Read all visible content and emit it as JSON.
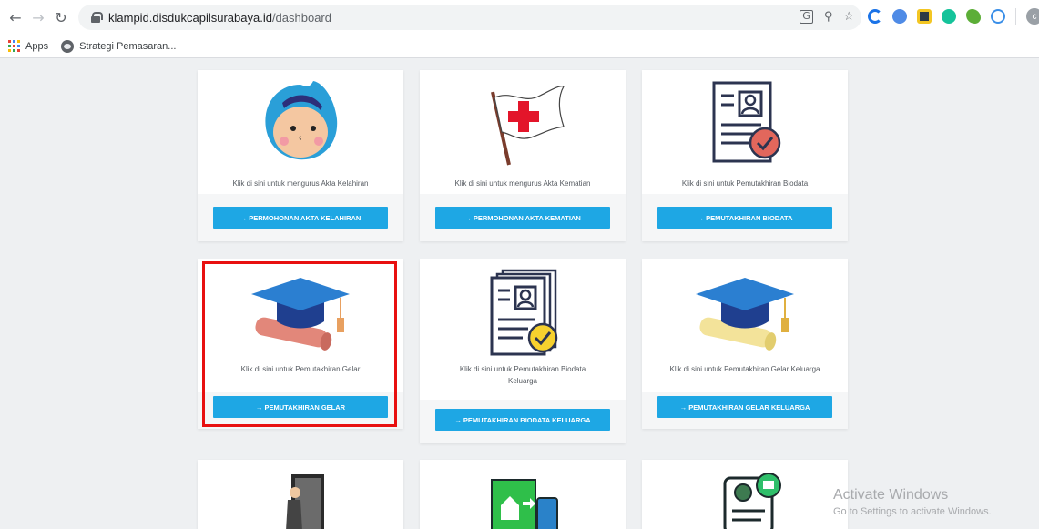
{
  "browser": {
    "url_host": "klampid.disdukcapilsurabaya.id",
    "url_path": "/dashboard",
    "avatar_letter": "c"
  },
  "bookmarks": {
    "apps_label": "Apps",
    "item_label": "Strategi Pemasaran..."
  },
  "cards": [
    {
      "desc": "Klik di sini untuk mengurus Akta Kelahiran",
      "button": "→ PERMOHONAN AKTA KELAHIRAN"
    },
    {
      "desc": "Klik di sini untuk mengurus Akta Kematian",
      "button": "→ PERMOHONAN AKTA KEMATIAN"
    },
    {
      "desc": "Klik di sini untuk Pemutakhiran Biodata",
      "button": "→ PEMUTAKHIRAN BIODATA"
    },
    {
      "desc": "Klik di sini untuk Pemutakhiran Gelar",
      "button": "→ PEMUTAKHIRAN GELAR"
    },
    {
      "desc": "Klik di sini untuk Pemutakhiran Biodata Keluarga",
      "button": "→ PEMUTAKHIRAN BIODATA KELUARGA"
    },
    {
      "desc": "Klik di sini untuk Pemutakhiran Gelar Keluarga",
      "button": "→ PEMUTAKHIRAN GELAR KELUARGA"
    }
  ],
  "watermark": {
    "title": "Activate Windows",
    "subtitle": "Go to Settings to activate Windows."
  },
  "colors": {
    "button": "#1ea7e4",
    "highlight": "#e81010",
    "page_bg": "#eef0f2"
  }
}
